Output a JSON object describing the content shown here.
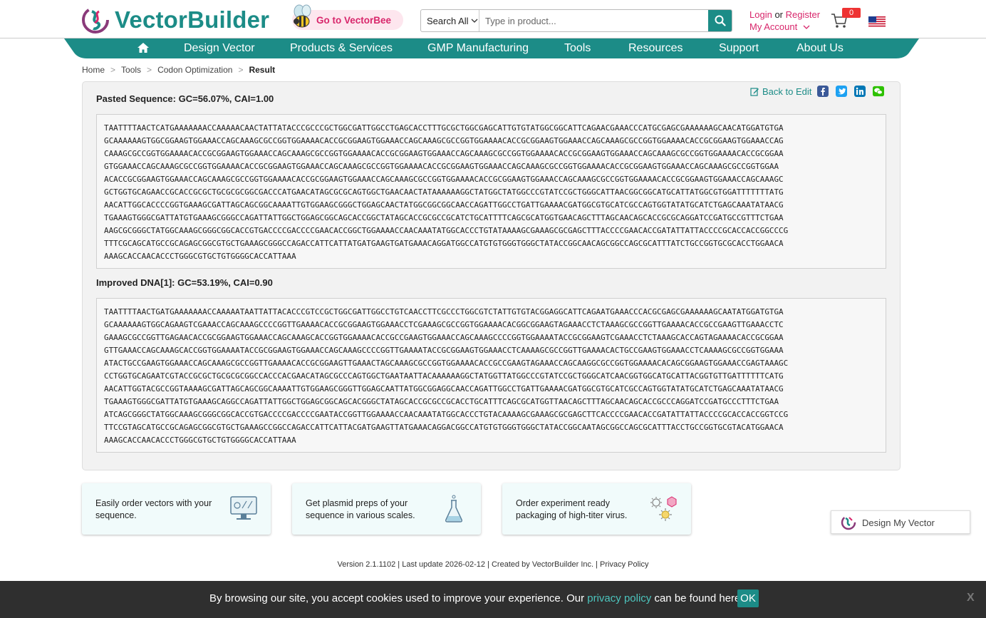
{
  "header": {
    "logo_text": "VectorBuilder",
    "bee_link": "Go to VectorBee",
    "search_scope": "Search All",
    "search_placeholder": "Type in product...",
    "login": "Login",
    "or": "or",
    "register": "Register",
    "my_account": "My Account",
    "cart_count": "0"
  },
  "nav": {
    "items": [
      "Design Vector",
      "Products & Services",
      "GMP Manufacturing",
      "Tools",
      "Resources",
      "Support",
      "About Us"
    ]
  },
  "breadcrumb": {
    "items": [
      "Home",
      "Tools",
      "Codon Optimization"
    ],
    "current": "Result"
  },
  "panel": {
    "back_to_edit": "Back to Edit",
    "pasted_title": "Pasted Sequence: GC=56.07%, CAI=1.00",
    "pasted_lines": [
      "TAATTTTAACTCATGAAAAAAACCAAAAACAACTATTATACCCGCCCGCTGGCGATTGGCCTGAGCACCTTTGCGCTGGCGAGCATTGTGTATGGCGGCATTCAGAACGAAACCCATGCGAGCGAAAAAAGCAACATGGATGTGA",
      "GCAAAAAAGTGGCGGAAGTGGAAACCAGCAAAGCGCCGGTGGAAAACACCGCGGAAGTGGAAACCAGCAAAGCGCCGGTGGAAAACACCGCGGAAGTGGAAACCAGCAAAGCGCCGGTGGAAAACACCGCGGAAGTGGAAACCAG",
      "CAAAGCGCCGGTGGAAAACACCGCGGAAGTGGAAACCAGCAAAGCGCCGGTGGAAAACACCGCGGAAGTGGAAACCAGCAAAGCGCCGGTGGAAAACACCGCGGAAGTGGAAACCAGCAAAGCGCCGGTGGAAAACACCGCGGAA",
      "GTGGAAACCAGCAAAGCGCCGGTGGAAAACACCGCGGAAGTGGAAACCAGCAAAGCGCCGGTGGAAAACACCGCGGAAGTGGAAACCAGCAAAGCGCCGGTGGAAAACACCGCGGAAGTGGAAACCAGCAAAGCGCCGGTGGAA",
      "ACACCGCGGAAGTGGAAACCAGCAAAGCGCCGGTGGAAAACACCGCGGAAGTGGAAACCAGCAAAGCGCCGGTGGAAAACACCGCGGAAGTGGAAACCAGCAAAGCGCCGGTGGAAAACACCGCGGAAGTGGAAACCAGCAAAGC",
      "GCTGGTGCAGAACCGCACCGCGCTGCGCGCGGCGACCCATGAACATAGCGCGCAGTGGCTGAACAACTATAAAAAAGGCTATGGCTATGGCCCGTATCCGCTGGGCATTAACGGCGGCATGCATTATGGCGTGGATTTTTTTATG",
      "AACATTGGCACCCCGGTGAAAGCGATTAGCAGCGGCAAAATTGTGGAAGCGGGCTGGAGCAACTATGGCGGCGGCAACCAGATTGGCCTGATTGAAAACGATGGCGTGCATCGCCAGTGGTATATGCATCTGAGCAAATATAACG",
      "TGAAAGTGGGCGATTATGTGAAAGCGGGCCAGATTATTGGCTGGAGCGGCAGCACCGGCTATAGCACCGCGCCGCATCTGCATTTTCAGCGCATGGTGAACAGCTTTAGCAACAGCACCGCGCAGGATCCGATGCCGTTTCTGAA",
      "AAGCGCGGGCTATGGCAAAGCGGGCGGCACCGTGACCCCGACCCCGAACACCGGCTGGAAAACCAACAAATATGGCACCCTGTATAAAAGCGAAAGCGCGAGCTTTACCCCGAACACCGATATTATTACCCCGCACCACCGGCCCG",
      "TTTCGCAGCATGCCGCAGAGCGGCGTGCTGAAAGCGGGCCAGACCATTCATTATGATGAAGTGATGAAACAGGATGGCCATGTGTGGGTGGGCTATACCGGCAACAGCGGCCAGCGCATTTATCTGCCGGTGCGCACCTGGAACA",
      "AAAGCACCAACACCCTGGGCGTGCTGTGGGGCACCATTAAA"
    ],
    "improved_title": "Improved DNA[1]: GC=53.19%, CAI=0.90",
    "improved_lines": [
      "TAATTTTAACTGATGAAAAAAACCAAAAATAATTATTACACCCGTCCGCTGGCGATTGGCCTGTCAACCTTCGCCCTGGCGTCTATTGTGTACGGAGGCATTCAGAATGAAACCCACGCGAGCGAAAAAAGCAATATGGATGTGA",
      "GCAAAAAAGTGGCAGAAGTCGAAACCAGCAAAGCCCCGGTTGAAAACACCGCGGAAGTGGAAACCTCGAAAGCGCCGGTGGAAAACACGGCGGAAGTAGAAACCTCTAAAGCGCCGGTTGAAAACACCGCCGAAGTTGAAACCTC",
      "GAAAGCGCCGGTTGAGAACACCGCGGAAGTGGAAACCAGCAAAGCACCGGTGGAAAACACCGCCGAAGTGGAAACCAGCAAAGCCCCGGTGGAAAATACCGCGGAAGTCGAAACCTCTAAAGCACCAGTAGAAAACACCGCGGAA",
      "GTTGAAACCAGCAAAGCACCGGTGGAAAATACCGCGGAAGTGGAAACCAGCAAAGCCCCGGTTGAAAATACCGCGGAAGTGGAAACCTCAAAAGCGCCGGTTGAAAACACTGCCGAAGTGGAAACCTCAAAAGCGCCGGTGGAAA",
      "ATACTGCCGAAGTGGAAACCAGCAAAGCGCCGGTTGAAAACACCGCGGAAGTTGAAACTAGCAAAGCGCCGGTGGAAAACACCGCCGAAGTAGAAACCAGCAAGGCGCCGGTGGAAAACACAGCGGAAGTGGAAACCGAGTAAAGC",
      "CCTGGTGCAGAATCGTACCGCGCTGCGCGCGGCCACCCACGAACATAGCGCCCAGTGGCTGAATAATTACAAAAAAGGCTATGGTTATGGCCCGTATCCGCTGGGCATCAACGGTGGCATGCATTACGGTGTTGATTTTTTCATG",
      "AACATTGGTACGCCGGTAAAAGCGATTAGCAGCGGCAAAATTGTGGAAGCGGGTTGGAGCAATTATGGCGGAGGCAACCAGATTGGCCTGATTGAAAACGATGGCGTGCATCGCCAGTGGTATATGCATCTGAGCAAATATAACG",
      "TGAAAGTGGGCGATTATGTGAAAGCAGGCCAGATTATTGGCTGGAGCGGCAGCACGGGCTATAGCACCGCGCCGCACCTGCATTTCAGCGCATGGTTAACAGCTTTAGCAACAGCACCGCCCAGGATCCGATGCCCTTTCTGAA",
      "ATCAGCGGGCTATGGCAAAGCGGGCGGCACCGTGACCCCGACCCCGAATACCGGTTGGAAAACCAACAAATATGGCACCCTGTACAAAAGCGAAAGCGCGAGCTTCACCCCGAACACCGATATTATTACCCCGCACCACCGGTCCG",
      "TTCCGTAGCATGCCGCAGAGCGGCGTGCTGAAAGCCGGCCAGACCATTCATTACGATGAAGTTATGAAACAGGACGGCCATGTGTGGGTGGGCTATACCGGCAATAGCGGCCAGCGCATTTACCTGCCGGTGCGTACATGGAACA",
      "AAAGCACCAACACCCTGGGCGTGCTGTGGGGCACCATTAAA"
    ]
  },
  "cards": [
    {
      "text": "Easily order vectors with your sequence."
    },
    {
      "text": "Get plasmid preps of your sequence in various scales."
    },
    {
      "text": "Order experiment ready packaging of high-titer virus."
    }
  ],
  "design_my_vector": "Design My Vector",
  "footer": {
    "line": "Version 2.1.1102 | Last update 2026-02-12 | Created by VectorBuilder Inc. | Privacy Policy"
  },
  "cookie": {
    "text_before": "By browsing our site, you accept cookies used to improve your experience. Our",
    "link": "privacy policy",
    "text_after": "can be found here.",
    "ok": "OK",
    "close": "X"
  },
  "colors": {
    "brand_teal": "#1c8c87",
    "brand_pink": "#d8266b",
    "cookie_bg": "#2f2f2f"
  }
}
